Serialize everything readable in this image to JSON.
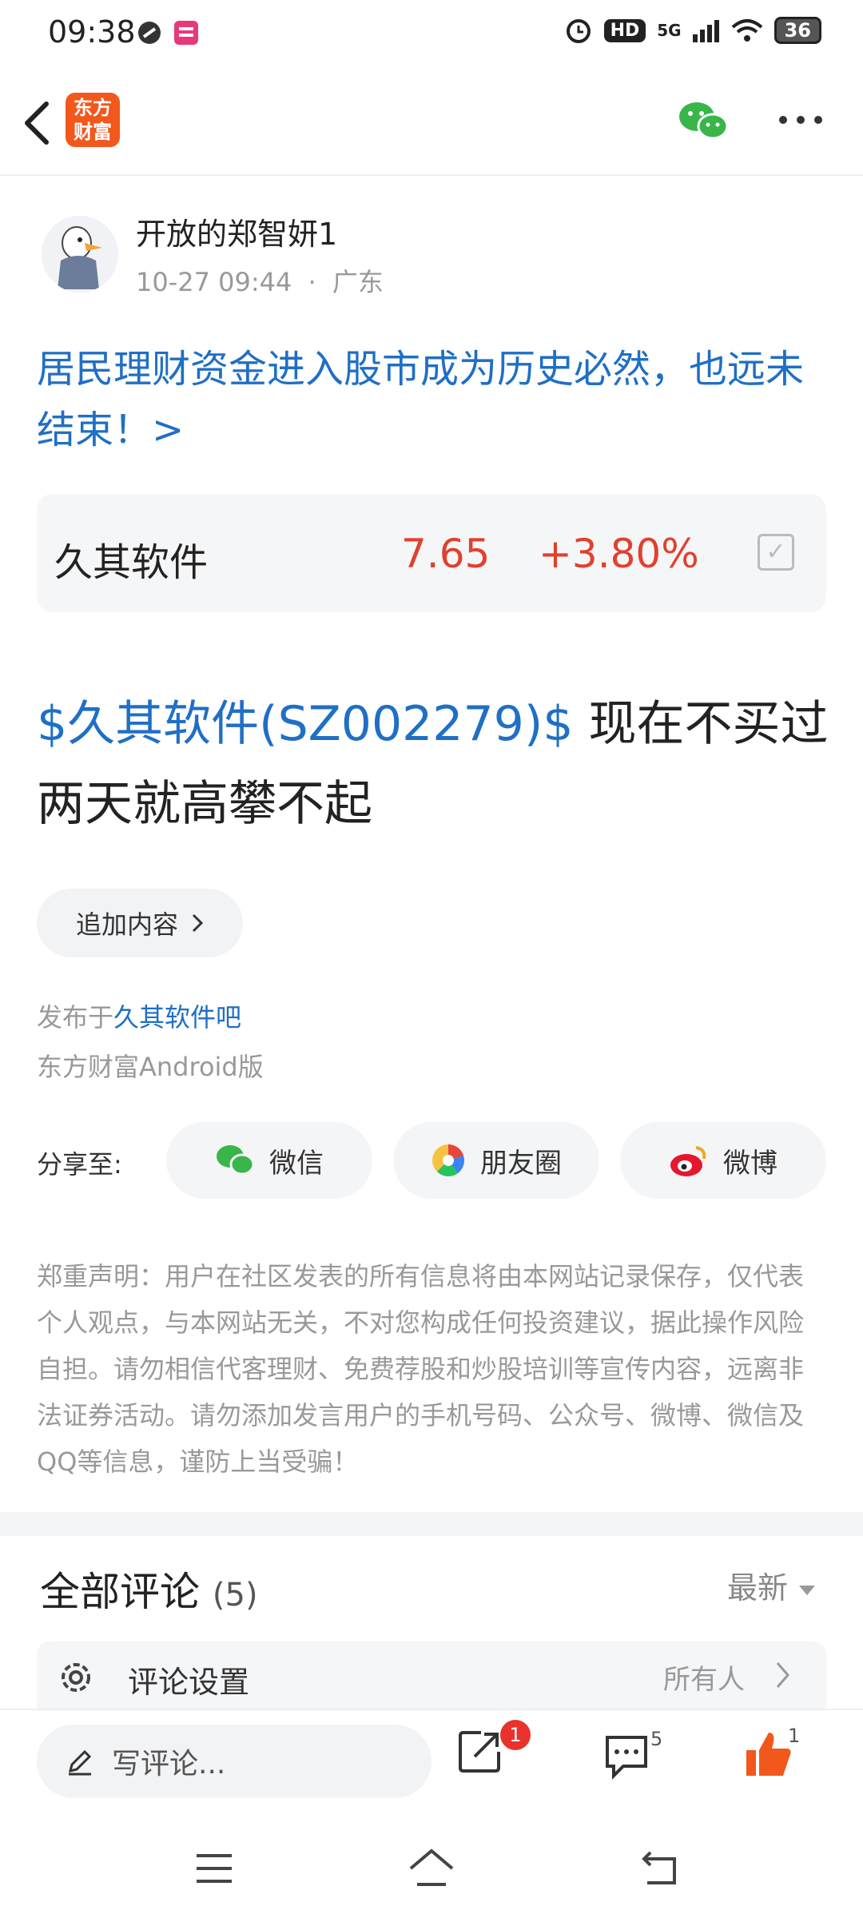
{
  "status_bar": {
    "time": "09:38",
    "battery": "36",
    "network": "5G",
    "hd": "HD"
  },
  "header": {
    "logo_line1": "东方",
    "logo_line2": "财富"
  },
  "post": {
    "author": "开放的郑智妍1",
    "date": "10-27 09:44",
    "location": "广东",
    "meta_sep": "·",
    "title": "居民理财资金进入股市成为历史必然，也远未结束！>",
    "stock": {
      "name": "久其软件",
      "price": "7.65",
      "change": "+3.80%"
    },
    "body_tag": "$久其软件(SZ002279)$",
    "body_text": " 现在不买过两天就高攀不起",
    "add_content": "追加内容",
    "published_prefix": "发布于",
    "published_bar": "久其软件吧",
    "client": "东方财富Android版"
  },
  "share": {
    "label": "分享至:",
    "items": [
      {
        "label": "微信",
        "icon": "wechat-icon"
      },
      {
        "label": "朋友圈",
        "icon": "moments-icon"
      },
      {
        "label": "微博",
        "icon": "weibo-icon"
      }
    ]
  },
  "disclaimer": "郑重声明：用户在社区发表的所有信息将由本网站记录保存，仅代表个人观点，与本网站无关，不对您构成任何投资建议，据此操作风险自担。请勿相信代客理财、免费荐股和炒股培训等宣传内容，远离非法证券活动。请勿添加发言用户的手机号码、公众号、微博、微信及QQ等信息，谨防上当受骗！",
  "comments": {
    "title": "全部评论",
    "count": "(5)",
    "sort": "最新",
    "settings_label": "评论设置",
    "settings_value": "所有人"
  },
  "bottom_bar": {
    "write_placeholder": "写评论...",
    "share_badge": "1",
    "comment_count": "5",
    "like_count": "1"
  },
  "colors": {
    "accent": "#f2581c",
    "link": "#1f6fc5",
    "up": "#e0412d",
    "wechat": "#39b54a"
  }
}
